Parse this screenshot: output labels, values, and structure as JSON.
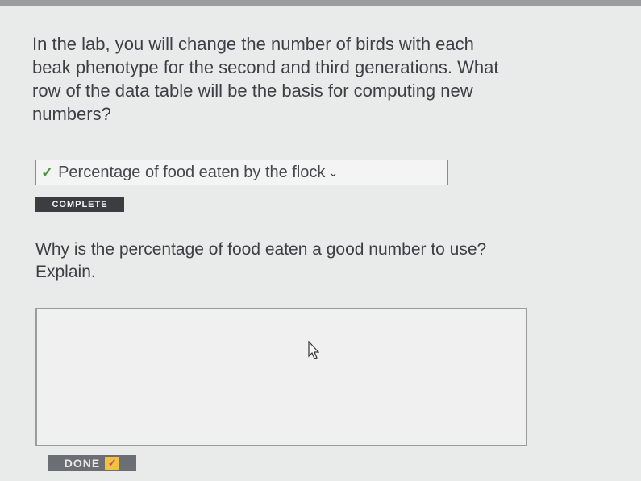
{
  "question1": {
    "text": "In the lab, you will change the number of birds with each beak phenotype for the second and third generations. What row of the data table will be the basis for computing new numbers?"
  },
  "dropdown": {
    "check_icon": "check-icon",
    "selected": "Percentage of food eaten by the flock",
    "chevron": "chevron-down-icon"
  },
  "status_badge": {
    "label": "COMPLETE"
  },
  "question2": {
    "text": "Why is the percentage of food eaten a good number to use? Explain."
  },
  "answer": {
    "value": ""
  },
  "done_button": {
    "label": "DONE",
    "icon": "check-icon"
  },
  "colors": {
    "background": "#e9ebea",
    "badge": "#3b3d40",
    "done_button": "#6b6e72",
    "check_green": "#4a9a3a",
    "done_check_bg": "#f0c240"
  }
}
